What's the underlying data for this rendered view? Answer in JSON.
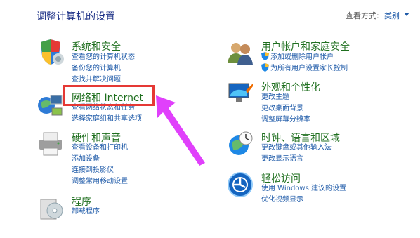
{
  "header": {
    "title": "调整计算机的设置",
    "view_by_label": "查看方式:",
    "view_mode": "类别"
  },
  "left": [
    {
      "icon": "security-shield-icon",
      "title": "系统和安全",
      "links": [
        "查看您的计算机状态",
        "备份您的计算机",
        "查找并解决问题"
      ]
    },
    {
      "icon": "network-globe-icon",
      "title": "网络和 Internet",
      "links": [
        "查看网络状态和任务",
        "选择家庭组和共享选项"
      ]
    },
    {
      "icon": "printer-icon",
      "title": "硬件和声音",
      "links": [
        "查看设备和打印机",
        "添加设备",
        "连接到投影仪",
        "调整常用移动设置"
      ]
    },
    {
      "icon": "program-box-icon",
      "title": "程序",
      "links": [
        "卸载程序"
      ]
    }
  ],
  "right": [
    {
      "icon": "users-icon",
      "title": "用户帐户和家庭安全",
      "links": [
        "添加或删除用户帐户",
        "为所有用户设置家长控制"
      ]
    },
    {
      "icon": "appearance-icon",
      "title": "外观和个性化",
      "links": [
        "更改主题",
        "更改桌面背景",
        "调整屏幕分辨率"
      ]
    },
    {
      "icon": "clock-globe-icon",
      "title": "时钟、语言和区域",
      "links": [
        "更改键盘或其他输入法",
        "更改显示语言"
      ]
    },
    {
      "icon": "ease-of-access-icon",
      "title": "轻松访问",
      "links": [
        "使用 Windows 建议的设置",
        "优化视频显示"
      ]
    }
  ],
  "colors": {
    "heading": "#1f6f1f",
    "link": "#1e5aa8",
    "highlight": "#e53935",
    "arrow": "#e040fb"
  }
}
